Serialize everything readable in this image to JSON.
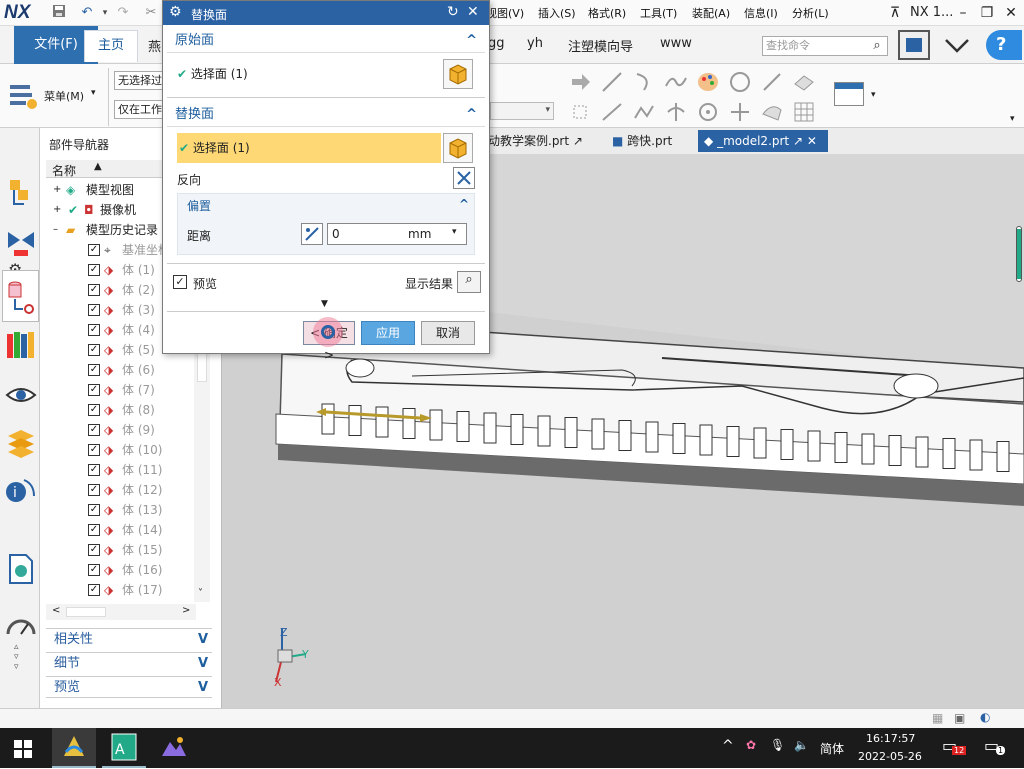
{
  "app": {
    "logo": "NX",
    "window_title": "NX 1...",
    "save_icon": "save-icon"
  },
  "menubar": [
    "视图(V)",
    "插入(S)",
    "格式(R)",
    "工具(T)",
    "装配(A)",
    "信息(I)",
    "分析(L)"
  ],
  "ribbon": {
    "tabs": [
      "文件(F)",
      "主页",
      "燕",
      "gg",
      "yh",
      "注塑模向导",
      "www"
    ],
    "active_tab": "主页",
    "search_placeholder": "查找命令",
    "menu_button": "菜单(M)",
    "select_filter": "无选择过",
    "select_scope": "仅在工作"
  },
  "doc_tabs": [
    {
      "label": "动教学案例.prt",
      "active": false
    },
    {
      "label": "跨快.prt",
      "active": false
    },
    {
      "label": "_model2.prt",
      "active": true
    }
  ],
  "navigator": {
    "title": "部件导航器",
    "column_name": "名称",
    "nodes": [
      {
        "label": "模型视图",
        "level": 0
      },
      {
        "label": "摄像机",
        "level": 0
      },
      {
        "label": "模型历史记录",
        "level": 0
      }
    ],
    "history_items": [
      "基准坐标",
      "体 (1)",
      "体 (2)",
      "体 (3)",
      "体 (4)",
      "体 (5)",
      "体 (6)",
      "体 (7)",
      "体 (8)",
      "体 (9)",
      "体 (10)",
      "体 (11)",
      "体 (12)",
      "体 (13)",
      "体 (14)",
      "体 (15)",
      "体 (16)",
      "体 (17)"
    ],
    "bottom_sections": [
      "相关性",
      "细节",
      "预览"
    ]
  },
  "dialog": {
    "title": "替换面",
    "section_original": "原始面",
    "original_select": "选择面 (1)",
    "section_replace": "替换面",
    "replace_select": "选择面 (1)",
    "reverse_label": "反向",
    "section_offset": "偏置",
    "distance_label": "距离",
    "distance_value": "0",
    "distance_unit": "mm",
    "preview_label": "预览",
    "preview_checked": true,
    "show_result_label": "显示结果",
    "ok_label": "< 确定 >",
    "apply_label": "应用",
    "cancel_label": "取消"
  },
  "axis": {
    "z": "Z",
    "y": "Y",
    "x": "X"
  },
  "taskbar": {
    "ime": "简体",
    "time": "16:17:57",
    "date": "2022-05-26",
    "notification_count": "12",
    "action_center_count": "1"
  },
  "colors": {
    "accent": "#2e6fb0",
    "highlight": "#fdd875",
    "dialog_title": "#2a62a4"
  }
}
